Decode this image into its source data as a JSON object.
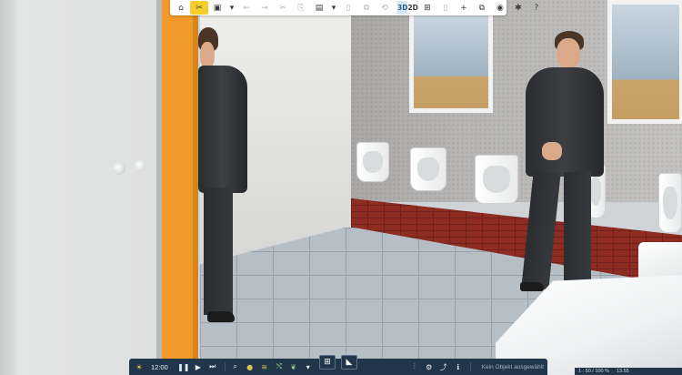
{
  "top_toolbar": {
    "items": [
      {
        "name": "home-icon",
        "glyph": "⌂",
        "state": "normal"
      },
      {
        "name": "tools-icon",
        "glyph": "✂",
        "state": "active-yellow"
      },
      {
        "name": "save-icon",
        "glyph": "▣",
        "state": "normal"
      },
      {
        "name": "save-dropdown-icon",
        "glyph": "▾",
        "state": "small"
      },
      {
        "name": "undo-icon",
        "glyph": "←",
        "state": "disabled"
      },
      {
        "name": "redo-icon",
        "glyph": "→",
        "state": "disabled"
      },
      {
        "name": "cut-icon",
        "glyph": "✂",
        "state": "disabled"
      },
      {
        "name": "copy-icon",
        "glyph": "⎘",
        "state": "disabled"
      },
      {
        "name": "paste-icon",
        "glyph": "▤",
        "state": "normal"
      },
      {
        "name": "paste-dropdown-icon",
        "glyph": "▾",
        "state": "small"
      },
      {
        "name": "delete-icon",
        "glyph": "▯",
        "state": "disabled"
      },
      {
        "name": "duplicate-icon",
        "glyph": "⧉",
        "state": "disabled"
      },
      {
        "name": "link-icon",
        "glyph": "⟲",
        "state": "disabled"
      }
    ],
    "view_3d": "3D",
    "view_2d": "2D",
    "right_items": [
      {
        "name": "grid-icon",
        "glyph": "⊞",
        "state": "normal"
      },
      {
        "name": "page-icon",
        "glyph": "▯",
        "state": "disabled"
      },
      {
        "name": "add-icon",
        "glyph": "+",
        "state": "normal"
      },
      {
        "name": "layers-icon",
        "glyph": "⧉",
        "state": "normal"
      },
      {
        "name": "camera-icon",
        "glyph": "◉",
        "state": "normal"
      },
      {
        "name": "plugin-icon",
        "glyph": "✱",
        "state": "normal"
      },
      {
        "name": "help-icon",
        "glyph": "?",
        "state": "normal"
      }
    ]
  },
  "bottom_toolbar": {
    "time": "12:00",
    "status": "Kein Objekt ausgewählt"
  },
  "corner_info": {
    "left": "1 : 50 / 100 %",
    "right": "13.55"
  },
  "colors": {
    "toolbar_bg": "#ffffff",
    "bottom_bar_bg": "#22364b",
    "active_yellow": "#f6cd2b",
    "stall_orange": "#f09a2a"
  }
}
